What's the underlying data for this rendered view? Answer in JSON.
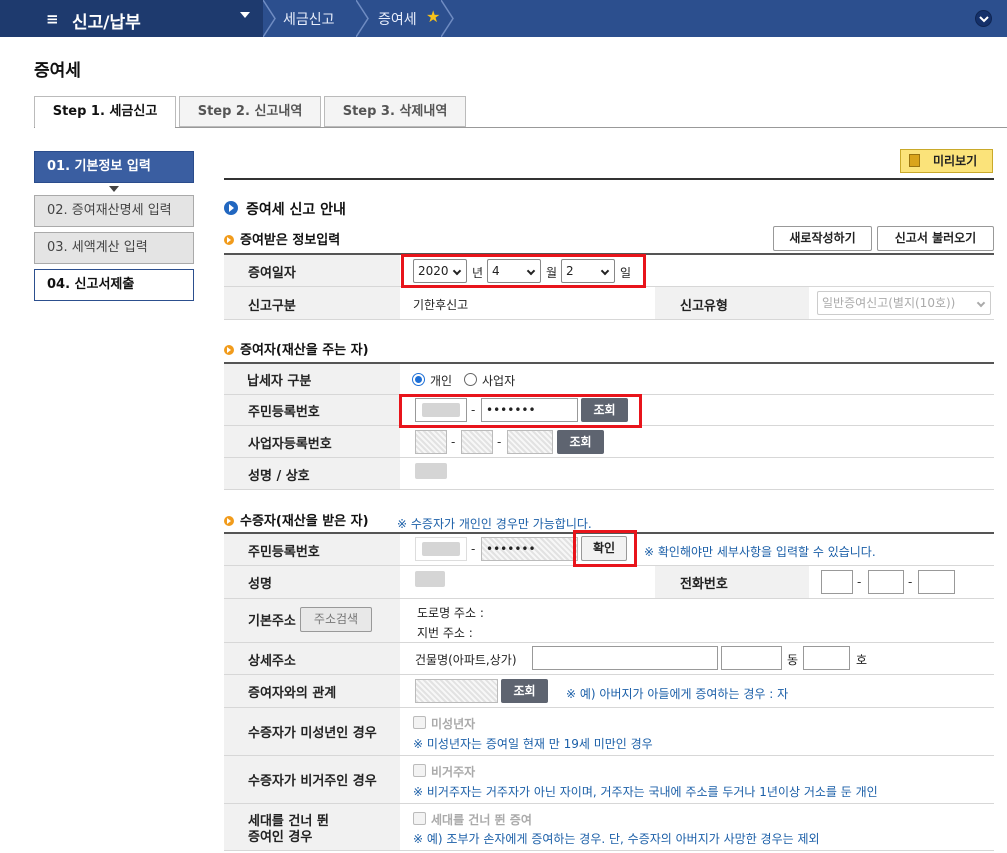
{
  "topbar": {
    "menu_icon": "≡",
    "menu_title": "신고/납부",
    "crumbs": [
      "세금신고",
      "증여세"
    ],
    "star": "★"
  },
  "page_title": "증여세",
  "tabs": [
    "Step 1. 세금신고",
    "Step 2. 신고내역",
    "Step 3. 삭제내역"
  ],
  "steps": [
    "01. 기본정보 입력",
    "02. 증여재산명세 입력",
    "03. 세액계산 입력",
    "04. 신고서제출"
  ],
  "preview_button": "미리보기",
  "guide_title": "증여세 신고 안내",
  "sections": {
    "received": "증여받은 정보입력",
    "donor": "증여자(재산을 주는 자)",
    "donee": "수증자(재산을 받은 자)"
  },
  "buttons": {
    "new": "새로작성하기",
    "load": "신고서 불러오기",
    "lookup": "조회",
    "confirm": "확인",
    "address_search": "주소검색"
  },
  "gift_info": {
    "date_label": "증여일자",
    "year": "2020",
    "year_unit": "년",
    "month": "4",
    "month_unit": "월",
    "day": "2",
    "day_unit": "일",
    "report_type_label": "신고구분",
    "report_type_value": "기한후신고",
    "report_kind_label": "신고유형",
    "report_kind_value": "일반증여신고(별지(10호))"
  },
  "donor": {
    "taxpayer_label": "납세자 구분",
    "radio_individual": "개인",
    "radio_business": "사업자",
    "rrn_label": "주민등록번호",
    "rrn_masked": "•••••••",
    "brn_label": "사업자등록번호",
    "name_label": "성명 / 상호"
  },
  "donee": {
    "note": "※ 수증자가 개인인 경우만 가능합니다.",
    "rrn_label": "주민등록번호",
    "rrn_masked": "•••••••",
    "confirm_note": "※ 확인해야만 세부사항을 입력할 수 있습니다.",
    "name_label": "성명",
    "phone_label": "전화번호",
    "address_label": "기본주소",
    "road_address": "도로명 주소 :",
    "lot_address": "지번 주소 :",
    "detail_label": "상세주소",
    "building_label": "건물명(아파트,상가)",
    "dong_unit": "동",
    "ho_unit": "호",
    "relation_label": "증여자와의 관계",
    "relation_note": "※ 예) 아버지가 아들에게 증여하는 경우 : 자",
    "minor_label": "수증자가 미성년인 경우",
    "minor_check": "미성년자",
    "minor_note": "※ 미성년자는 증여일 현재 만 19세 미만인 경우",
    "nonresident_label": "수증자가 비거주인 경우",
    "nonresident_check": "비거주자",
    "nonresident_note": "※ 비거주자는 거주자가 아닌 자이며, 거주자는 국내에 주소를 두거나 1년이상 거소를 둔 개인",
    "generation_label_1": "세대를 건너 뛴",
    "generation_label_2": "증여인 경우",
    "generation_check": "세대를 건너 뛴 증여",
    "generation_note": "※ 예) 조부가 손자에게 증여하는 경우. 단, 수증자의 아버지가 사망한 경우는 제외"
  },
  "colors": {
    "topbar": "#2c4f8e",
    "step_active": "#3a5ea1",
    "highlight_box": "#e8141b",
    "note_text": "#1b5fa8",
    "section_bullet": "#f19b1b"
  }
}
